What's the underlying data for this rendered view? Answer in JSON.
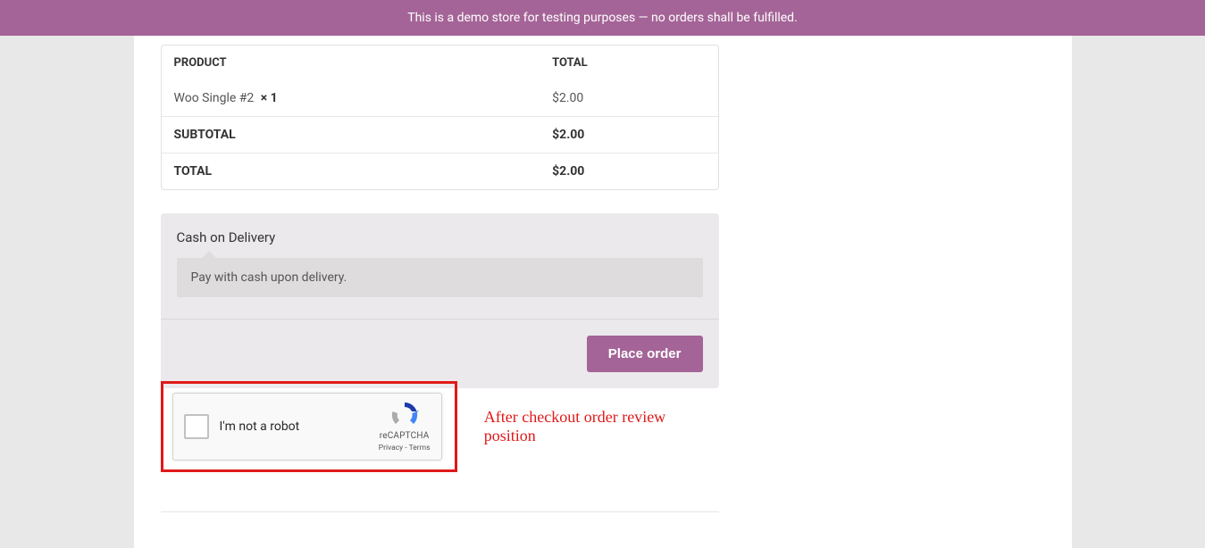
{
  "banner": {
    "text": "This is a demo store for testing purposes — no orders shall be fulfilled."
  },
  "order_table": {
    "headers": {
      "product": "PRODUCT",
      "total": "TOTAL"
    },
    "product": {
      "name": "Woo Single #2",
      "qty": "× 1",
      "price": "$2.00"
    },
    "subtotal": {
      "label": "SUBTOTAL",
      "value": "$2.00"
    },
    "total": {
      "label": "TOTAL",
      "value": "$2.00"
    }
  },
  "payment": {
    "method_title": "Cash on Delivery",
    "description": "Pay with cash upon delivery.",
    "button_label": "Place order"
  },
  "recaptcha": {
    "checkbox_label": "I'm not a robot",
    "brand": "reCAPTCHA",
    "privacy": "Privacy",
    "terms": "Terms",
    "separator": " - "
  },
  "annotation": "After checkout order review position"
}
